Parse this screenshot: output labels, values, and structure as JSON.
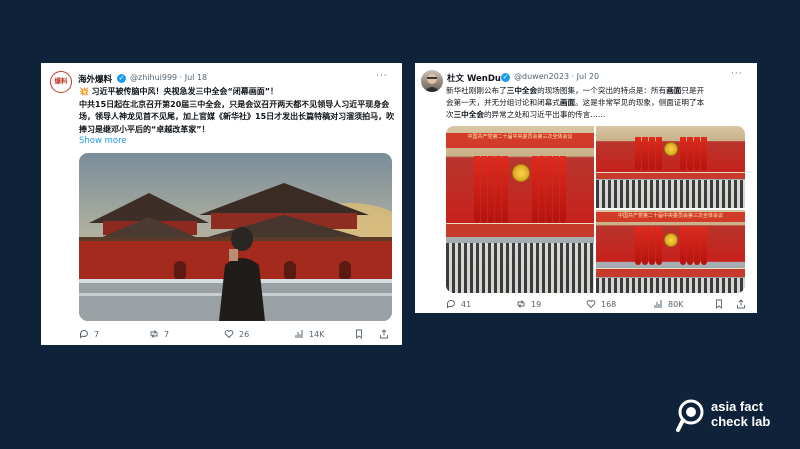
{
  "post_left": {
    "avatar_text": "爆料",
    "user_name": "海外爆料",
    "handle_date": "@zhihui999 · Jul 18",
    "more": "···",
    "headline": "习近平被传脑中风！央视急发三中全会“闭幕画面”！",
    "headline_icon": "explosion-emoji",
    "body": "中共15日起在北京召开第20届三中全会，只是会议召开两天都不见领导人习近平现身会场，领导人神龙见首不见尾，加上官媒《新华社》15日才发出长篇特稿对习溜须拍马，吹捧习是继邓小平后的“卓越改革家”！",
    "show_more": "Show more",
    "image": "forbidden-city-photo",
    "stats": {
      "replies": "7",
      "reposts": "7",
      "likes": "26",
      "views": "14K"
    }
  },
  "post_right": {
    "user_name": "杜文 WenDu",
    "handle_date": "@duwen2023 · Jul 20",
    "more": "···",
    "body_lines": [
      [
        "新华社刚刚公布了",
        "三中全会",
        "的现场图集，一个突出的特点是：所有",
        "画面",
        "只是开"
      ],
      [
        "会第一天，并无分组讨论和闭幕式",
        "画面",
        "。这是非常罕见的现象，侧面证明了本"
      ],
      [
        "次",
        "三中全会",
        "的异常之处和习近平出事的传言……"
      ]
    ],
    "image": "plenum-photo-collage",
    "banner": "中国共产党第二十届中央委员会第三次全体会议",
    "stats": {
      "replies": "41",
      "reposts": "19",
      "likes": "168",
      "views": "80K"
    }
  },
  "logo": {
    "line1": "asia fact",
    "line2": "check lab"
  },
  "colors": {
    "background": "#0e2239",
    "link": "#1d9bf0",
    "muted": "#536471"
  }
}
